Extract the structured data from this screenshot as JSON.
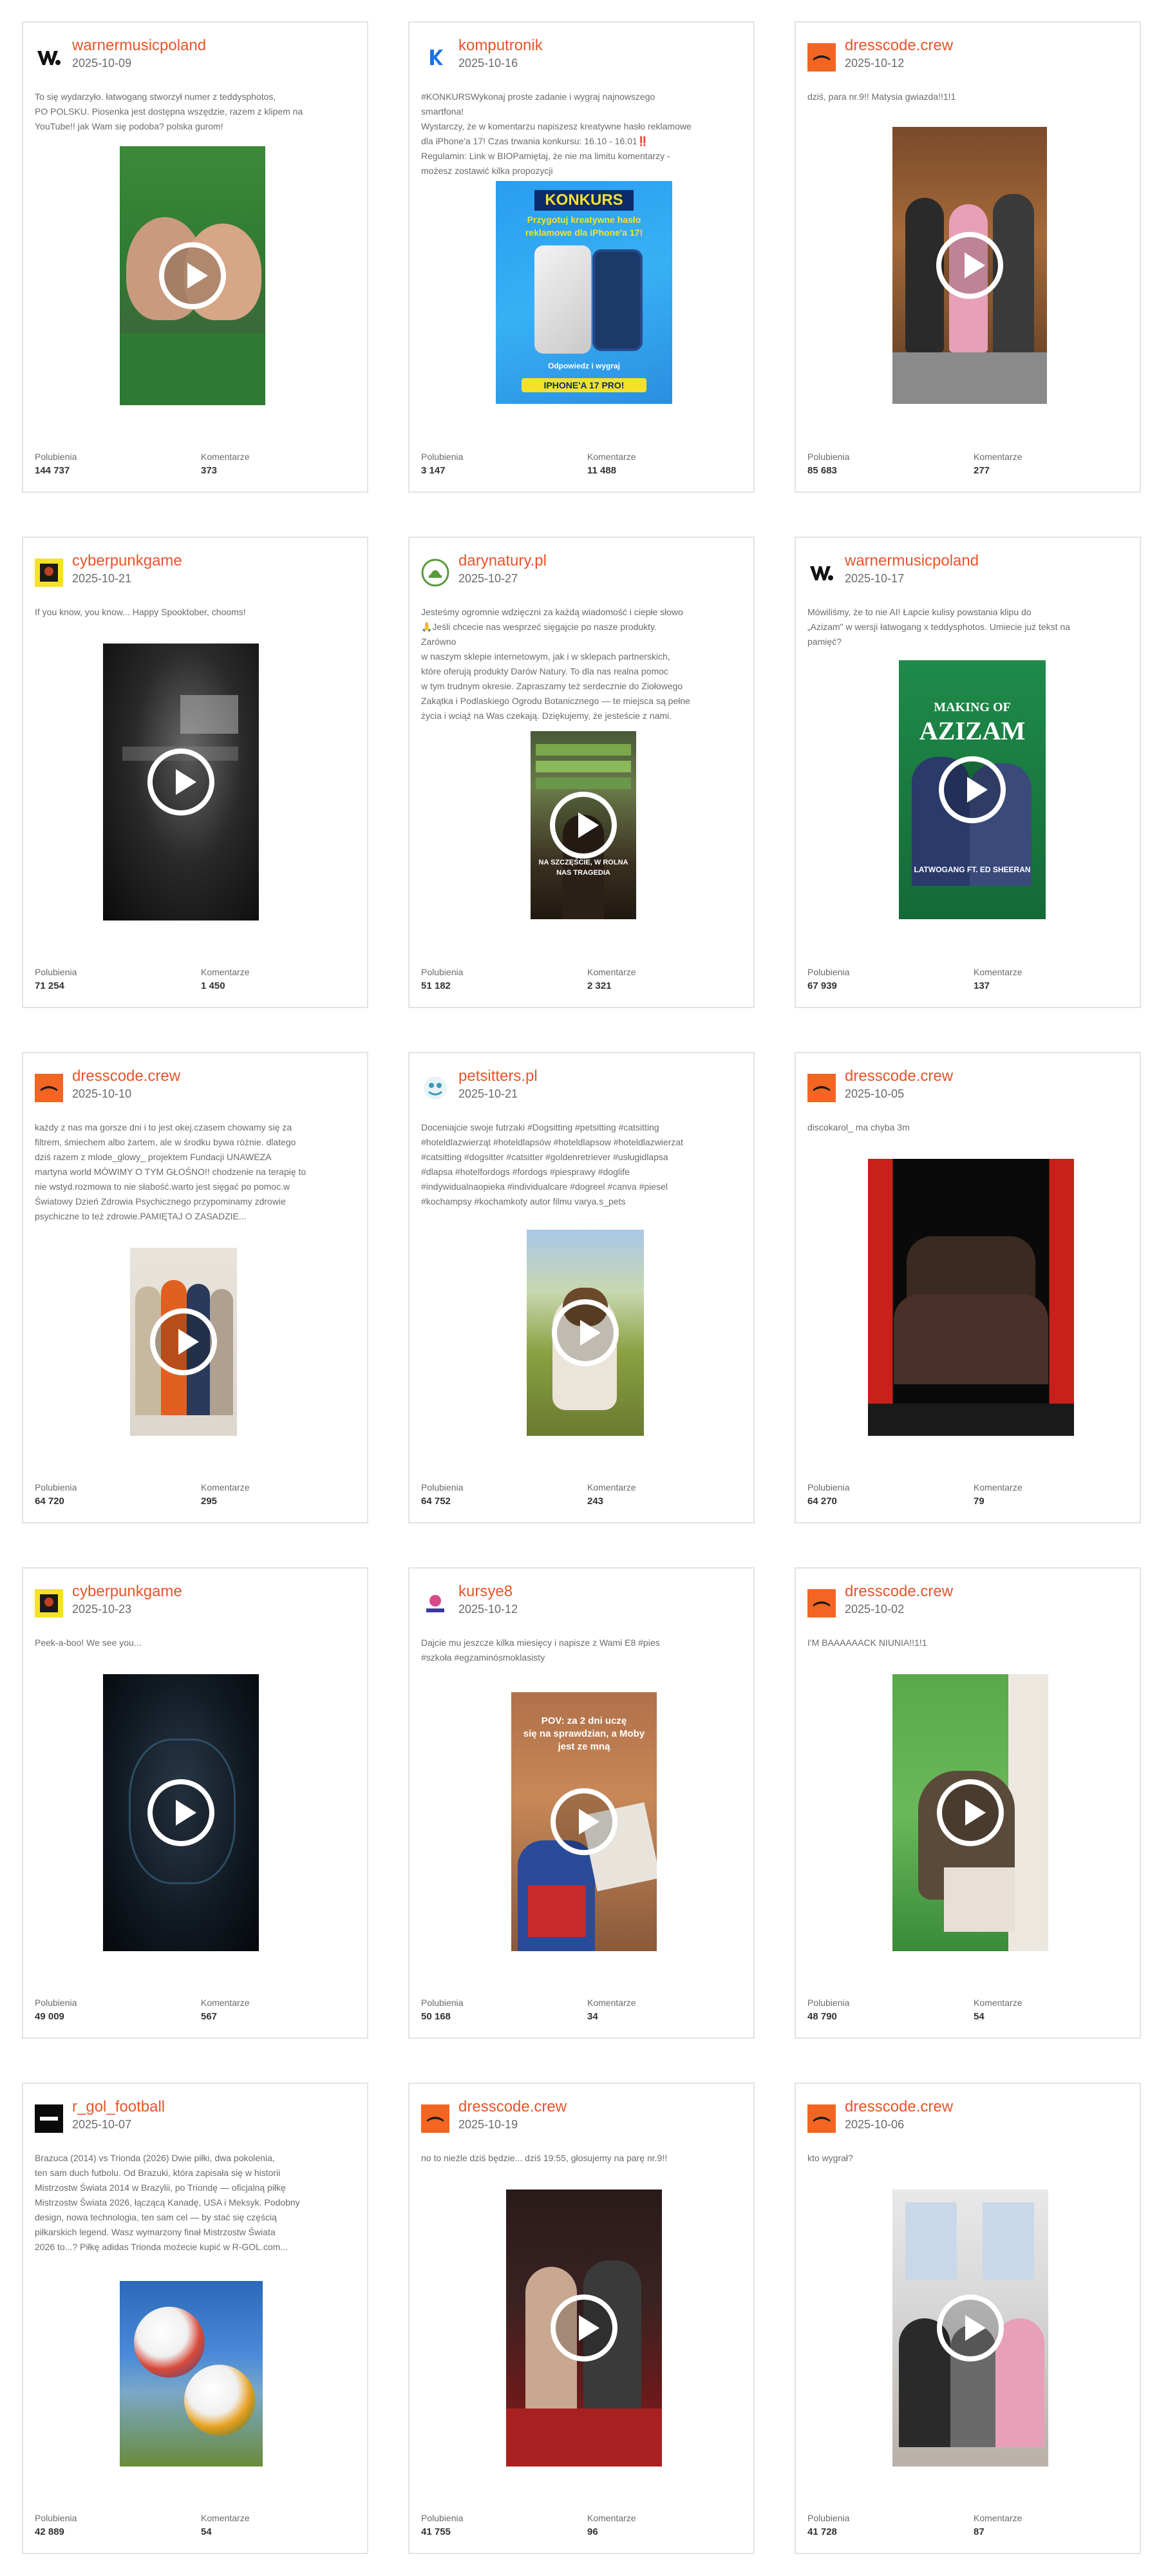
{
  "labels": {
    "likes": "Polubienia",
    "comments": "Komentarze"
  },
  "posts": [
    {
      "author": "warnermusicpoland",
      "date": "2025-10-09",
      "avatar_icon": "warner-logo-icon",
      "text": "To się wydarzyło. łatwogang stworzył numer z teddysphotos,\nPO POLSKU. Piosenka jest dostępna wszędzie, razem z klipem na\nYouTube!! jak Wam się podoba? polska gurom!",
      "likes": "144 737",
      "comments": "373"
    },
    {
      "author": "komputronik",
      "date": "2025-10-16",
      "avatar_icon": "komputronik-logo-icon",
      "text": "#KONKURSWykonaj proste zadanie i wygraj najnowszego smartfona!\nWystarczy, że w komentarzu napiszesz kreatywne hasło reklamowe\ndla iPhone'a 17!  Czas trwania konkursu: 16.10 - 16.01‼️\nRegulamin: Link w BIOPamiętaj, że nie ma limitu komentarzy -\nmożesz zostawić kilka propozycji",
      "likes": "3 147",
      "comments": "11 488",
      "overlay": {
        "title": "KONKURS",
        "line1": "Przygotuj kreatywne hasło",
        "line2": "reklamowe dla iPhone'a 17!",
        "line3": "Odpowiedz i wygraj",
        "cta": "IPHONE'A 17 PRO!"
      }
    },
    {
      "author": "dresscode.crew",
      "date": "2025-10-12",
      "avatar_icon": "dresscode-logo-icon",
      "text": "dziś, para nr.9!! Matysia gwiazda!!1!1",
      "likes": "85 683",
      "comments": "277"
    },
    {
      "author": "cyberpunkgame",
      "date": "2025-10-21",
      "avatar_icon": "cyberpunk-logo-icon",
      "text": "If you know, you know... Happy Spooktober, chooms!",
      "likes": "71 254",
      "comments": "1 450"
    },
    {
      "author": "darynatury.pl",
      "date": "2025-10-27",
      "avatar_icon": "darynatury-logo-icon",
      "text": "Jesteśmy ogromnie wdzięczni za każdą wiadomość i ciepłe słowo\n🙏Jeśli chcecie nas wesprzeć sięgajcie po nasze produkty. Zarówno\nw naszym sklepie internetowym, jak i w sklepach partnerskich,\nktóre oferują produkty Darów Natury. To dla nas realna pomoc\nw tym trudnym okresie. Zapraszamy też serdecznie do Ziołowego\nZakątka i Podlaskiego Ogrodu Botanicznego — te miejsca są pełne\nżycia i wciąż na Was czekają. Dziękujemy, że jesteście z nami.",
      "likes": "51 182",
      "comments": "2 321",
      "overlay": {
        "line1": "NA SZCZĘŚCIE, W ROLNA",
        "line2": "NAS TRAGEDIA"
      }
    },
    {
      "author": "warnermusicpoland",
      "date": "2025-10-17",
      "avatar_icon": "warner-logo-icon",
      "text": "Mówiliśmy, że to nie AI! Łapcie kulisy powstania klipu do\n„Azizam\" w wersji łatwogang x teddysphotos. Umiecie już tekst na\npamięć?",
      "likes": "67 939",
      "comments": "137",
      "overlay": {
        "line1": "MAKING OF",
        "line2": "AZIZAM",
        "line3": "LATWOGANG FT. ED SHEERAN"
      }
    },
    {
      "author": "dresscode.crew",
      "date": "2025-10-10",
      "avatar_icon": "dresscode-logo-icon",
      "text": "każdy z nas ma gorsze dni i to jest okej.czasem chowamy się za\nfiltrem, śmiechem albo żartem, ale w środku bywa różnie. dlatego\ndziś razem z mlode_glowy_ projektem Fundacji UNAWEZA\nmartyna world MÓWIMY O TYM GŁOŚNO!! chodzenie na terapię to\nnie wstyd.rozmowa to nie słabość.warto jest sięgać po pomoc.w\nŚwiatowy Dzień Zdrowia Psychicznego przypominamy zdrowie\npsychiczne to też zdrowie.PAMIĘTAJ O ZASADZIE...",
      "likes": "64 720",
      "comments": "295"
    },
    {
      "author": "petsitters.pl",
      "date": "2025-10-21",
      "avatar_icon": "petsitters-logo-icon",
      "text": "Doceniajcie swoje futrzaki #Dogsitting #petsitting #catsitting\n#hoteldlazwierząt #hoteldlapsów #hoteldlapsow #hoteldlazwierzat\n#catsitting #dogsitter #catsitter #goldenretriever #usługidlapsa\n#dlapsa #hotelfordogs #fordogs #piesprawy #doglife\n#indywidualnaopieka #individualcare #dogreel #canva #piesel\n#kochampsy #kochamkoty autor filmu varya.s_pets",
      "likes": "64 752",
      "comments": "243"
    },
    {
      "author": "dresscode.crew",
      "date": "2025-10-05",
      "avatar_icon": "dresscode-logo-icon",
      "text": "discokarol_ ma chyba 3m",
      "likes": "64 270",
      "comments": "79"
    },
    {
      "author": "cyberpunkgame",
      "date": "2025-10-23",
      "avatar_icon": "cyberpunk-logo-icon",
      "text": "Peek-a-boo! We see you...",
      "likes": "49 009",
      "comments": "567"
    },
    {
      "author": "kursye8",
      "date": "2025-10-12",
      "avatar_icon": "kursye8-logo-icon",
      "text": "Dajcie mu jeszcze kilka miesięcy i napisze z Wami E8 #pies\n#szkoła #egzaminósmoklasisty",
      "likes": "50 168",
      "comments": "34",
      "overlay": {
        "line1": "POV: za 2 dni uczę",
        "line2": "się na sprawdzian, a Moby",
        "line3": "jest ze mną"
      }
    },
    {
      "author": "dresscode.crew",
      "date": "2025-10-02",
      "avatar_icon": "dresscode-logo-icon",
      "text": "I'M BAAAAAACK NIUNIA!!1!1",
      "likes": "48 790",
      "comments": "54"
    },
    {
      "author": "r_gol_football",
      "date": "2025-10-07",
      "avatar_icon": "rgol-logo-icon",
      "text": "Brazuca (2014) vs Trionda (2026) Dwie piłki, dwa pokolenia,\nten sam duch futbolu. Od Brazuki, która zapisała się w historii\nMistrzostw Świata 2014 w Brazylii, po Triondę — oficjalną piłkę\nMistrzostw Świata 2026, łączącą Kanadę, USA i Meksyk. Podobny\ndesign, nowa technologia, ten sam cel — by stać się częścią\npiłkarskich legend. Wasz wymarzony finał Mistrzostw Świata\n2026 to...? Piłkę adidas Trionda możecie kupić w R-GOL.com...",
      "likes": "42 889",
      "comments": "54"
    },
    {
      "author": "dresscode.crew",
      "date": "2025-10-19",
      "avatar_icon": "dresscode-logo-icon",
      "text": "no to nieźle dziś będzie... dziś 19:55, głosujemy na parę nr.9!!",
      "likes": "41 755",
      "comments": "96"
    },
    {
      "author": "dresscode.crew",
      "date": "2025-10-06",
      "avatar_icon": "dresscode-logo-icon",
      "text": "kto wygrał?",
      "likes": "41 728",
      "comments": "87"
    }
  ]
}
